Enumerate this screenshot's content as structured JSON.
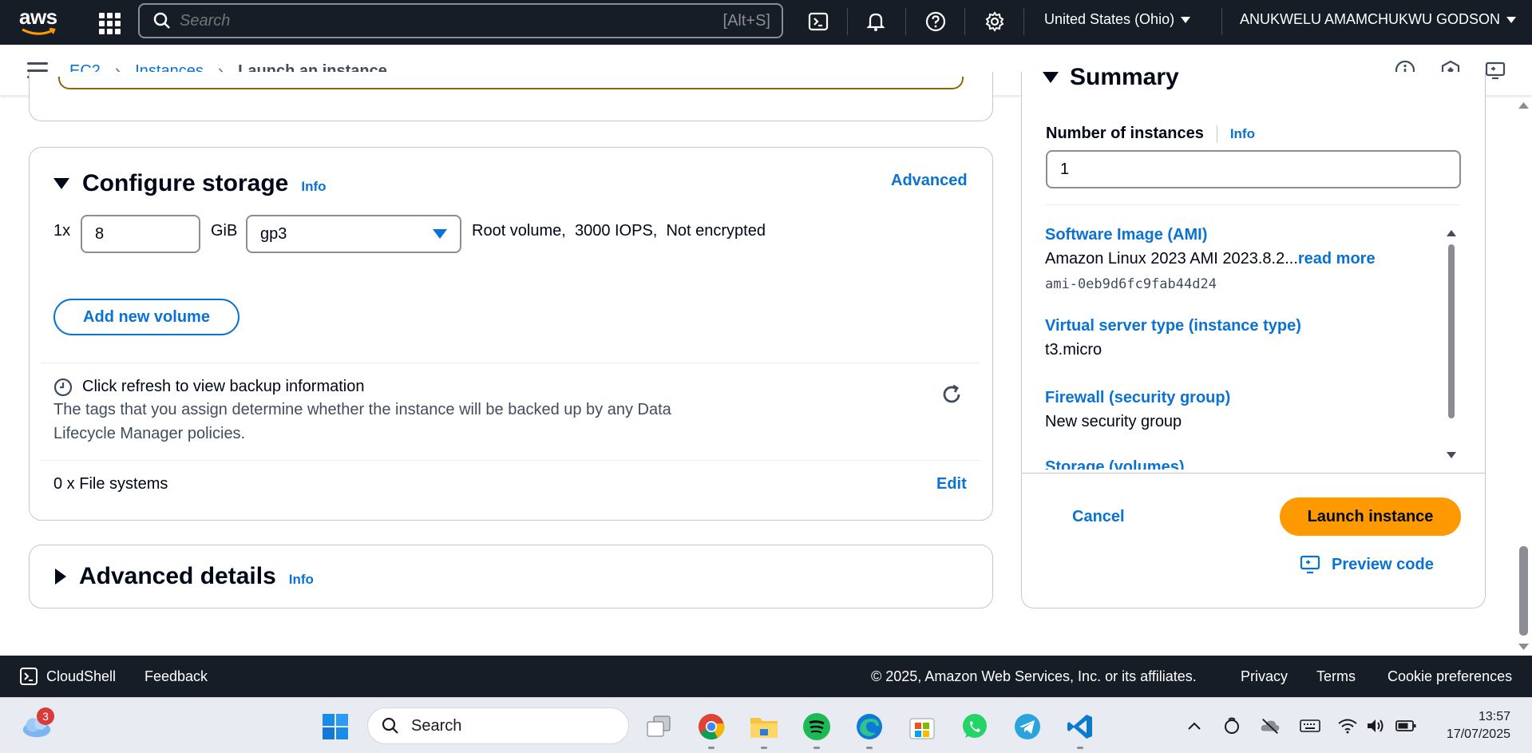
{
  "topnav": {
    "logo_text": "aws",
    "search_placeholder": "Search",
    "search_shortcut": "[Alt+S]",
    "region": "United States (Ohio)",
    "user": "ANUKWELU AMAMCHUKWU GODSON",
    "icons": [
      "apps-grid-icon",
      "cloudshell-icon",
      "bell-icon",
      "help-icon",
      "gear-icon"
    ]
  },
  "breadcrumb": {
    "items": [
      "EC2",
      "Instances"
    ],
    "current": "Launch an instance"
  },
  "storage": {
    "title": "Configure storage",
    "info": "Info",
    "advanced": "Advanced",
    "multiplier": "1x",
    "size": "8",
    "unit": "GiB",
    "volume_type": "gp3",
    "volume_desc": "Root volume,  3000 IOPS,  Not encrypted",
    "add_volume": "Add new volume",
    "backup_title": "Click refresh to view backup information",
    "backup_desc_line1": "The tags that you assign determine whether the instance will be backed up by any Data",
    "backup_desc_line2": "Lifecycle Manager policies.",
    "file_systems": "0 x File systems",
    "edit": "Edit"
  },
  "advanced_details": {
    "title": "Advanced details",
    "info": "Info"
  },
  "summary": {
    "title": "Summary",
    "num_instances_label": "Number of instances",
    "info": "Info",
    "num_instances_value": "1",
    "ami_label": "Software Image (AMI)",
    "ami_value": "Amazon Linux 2023 AMI 2023.8.2...",
    "read_more": "read more",
    "ami_id": "ami-0eb9d6fc9fab44d24",
    "type_label": "Virtual server type (instance type)",
    "type_value": "t3.micro",
    "firewall_label": "Firewall (security group)",
    "firewall_value": "New security group",
    "storage_label": "Storage (volumes)",
    "cancel": "Cancel",
    "launch": "Launch instance",
    "preview": "Preview code"
  },
  "footer": {
    "cloudshell": "CloudShell",
    "feedback": "Feedback",
    "copyright": "© 2025, Amazon Web Services, Inc. or its affiliates.",
    "privacy": "Privacy",
    "terms": "Terms",
    "cookies": "Cookie preferences"
  },
  "taskbar": {
    "search": "Search",
    "weather_badge": "3",
    "time": "13:57",
    "date": "17/07/2025"
  },
  "colors": {
    "nav_bg": "#161d26",
    "link": "#0972d3",
    "primary": "#ff9900"
  }
}
